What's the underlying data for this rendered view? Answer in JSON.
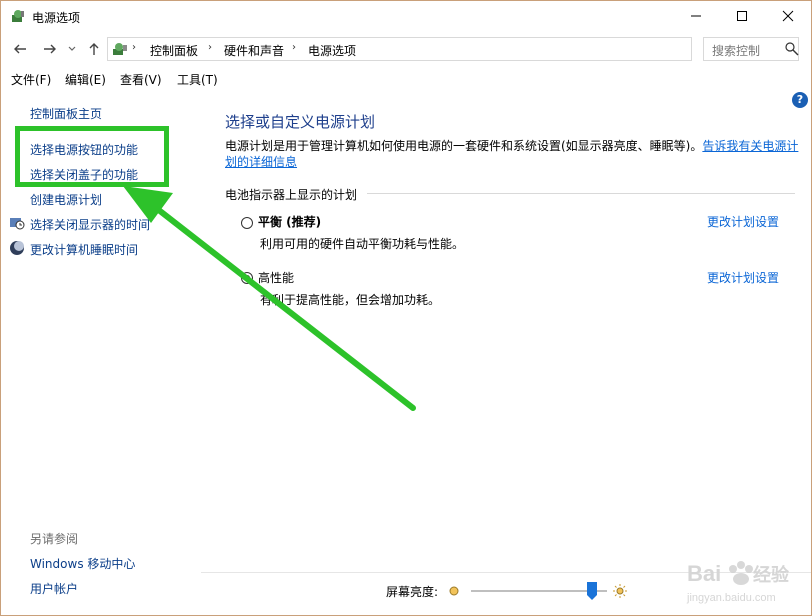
{
  "window": {
    "title": "电源选项",
    "controls": [
      "minimize-icon",
      "maximize-icon",
      "close-icon"
    ]
  },
  "address": {
    "crumbs": [
      "控制面板",
      "硬件和声音",
      "电源选项"
    ],
    "search_placeholder": "搜索控制"
  },
  "menu": {
    "file": "文件(F)",
    "edit": "编辑(E)",
    "view": "查看(V)",
    "tools": "工具(T)"
  },
  "sidebar": {
    "home": "控制面板主页",
    "items": [
      "选择电源按钮的功能",
      "选择关闭盖子的功能",
      "创建电源计划",
      "选择关闭显示器的时间",
      "更改计算机睡眠时间"
    ],
    "see_also_title": "另请参阅",
    "see_also": [
      "Windows 移动中心",
      "用户帐户"
    ]
  },
  "main": {
    "title": "选择或自定义电源计划",
    "description": "电源计划是用于管理计算机如何使用电源的一套硬件和系统设置(如显示器亮度、睡眠等)。",
    "description_link": "告诉我有关电源计划的详细信息",
    "section_label": "电池指示器上显示的计划",
    "plans": [
      {
        "name": "平衡 (推荐)",
        "desc": "利用可用的硬件自动平衡功耗与性能。",
        "link": "更改计划设置",
        "selected": false
      },
      {
        "name": "高性能",
        "desc": "有利于提高性能，但会增加功耗。",
        "link": "更改计划设置",
        "selected": true
      }
    ],
    "help": "?"
  },
  "brightness": {
    "label": "屏幕亮度:",
    "value_fraction": 0.92
  },
  "colors": {
    "link": "#0b66d6",
    "title": "#1e3f8c",
    "highlight": "#2dc22a"
  }
}
